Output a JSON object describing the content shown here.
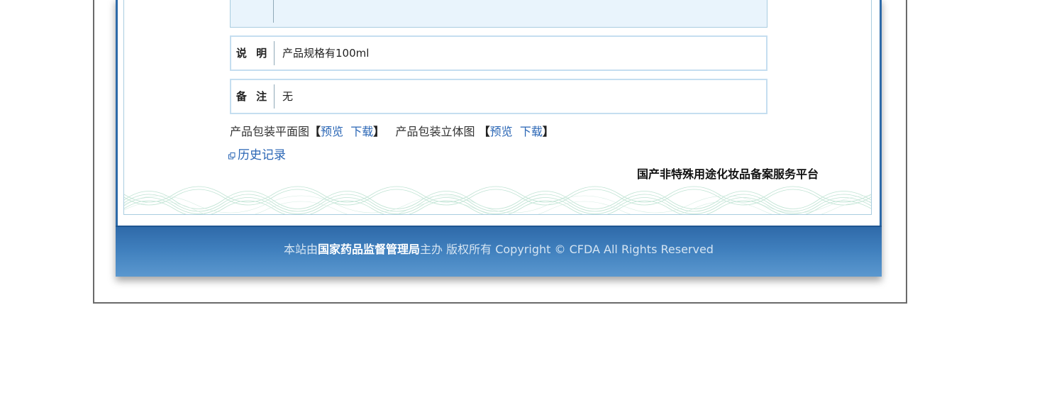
{
  "record": {
    "fields": [
      {
        "label": "说 明",
        "value": "产品规格有100ml"
      },
      {
        "label": "备 注",
        "value": "无"
      }
    ],
    "packaging": {
      "flat_label": "产品包装平面图",
      "flat_preview": "预览",
      "flat_download": "下载",
      "solid_label": "产品包装立体图",
      "solid_preview": "预览",
      "solid_download": "下载",
      "bracket_open": "【",
      "bracket_close": "】"
    },
    "history_label": "历史记录",
    "platform_name": "国产非特殊用途化妆品备案服务平台"
  },
  "footer": {
    "prefix": "本站由",
    "organization": "国家药品监督管理局",
    "suffix": "主办 版权所有 Copyright © CFDA All Rights Reserved"
  },
  "colors": {
    "link": "#2a66b5",
    "footer_top": "#2f6aa9",
    "footer_bottom": "#5b98cf",
    "row_border": "#c5def0",
    "top_row_bg": "#e9f4fc"
  }
}
